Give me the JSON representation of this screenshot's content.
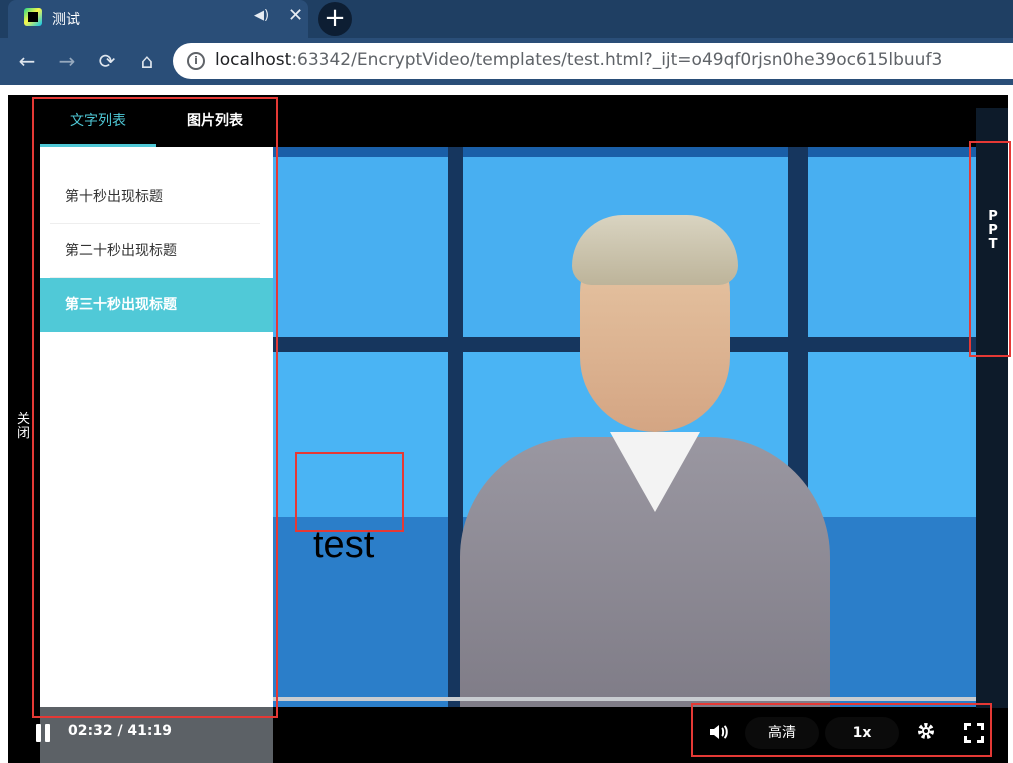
{
  "browser": {
    "tab_title": "测试",
    "tab_audio_icon": "speaker-icon",
    "tab_close_glyph": "✕",
    "new_tab_glyph": "+",
    "url_host": "localhost",
    "url_rest": ":63342/EncryptVideo/templates/test.html?_ijt=o49qf0rjsn0he39oc615lbuuf3",
    "back_glyph": "←",
    "forward_glyph": "→",
    "reload_glyph": "⟳",
    "home_glyph": "⌂",
    "info_glyph": "i"
  },
  "side_panel": {
    "tabs": [
      "文字列表",
      "图片列表"
    ],
    "active_tab": "文字列表",
    "items": [
      "第十秒出现标题",
      "第二十秒出现标题",
      "第三十秒出现标题"
    ],
    "active_item": "第三十秒出现标题",
    "close_label": "关闭"
  },
  "ppt": {
    "label": "PPT"
  },
  "video": {
    "overlay_text": "test",
    "progress": 0.0614
  },
  "controls": {
    "time": "02:32 / 41:19",
    "quality": "高清",
    "speed": "1x",
    "volume_icon": "speaker-icon",
    "settings_icon": "gear-icon",
    "fullscreen_icon": "fullscreen-icon"
  },
  "colors": {
    "accent": "#4fc8d6",
    "annotation": "#e53935",
    "chrome": "#2a4e78"
  }
}
